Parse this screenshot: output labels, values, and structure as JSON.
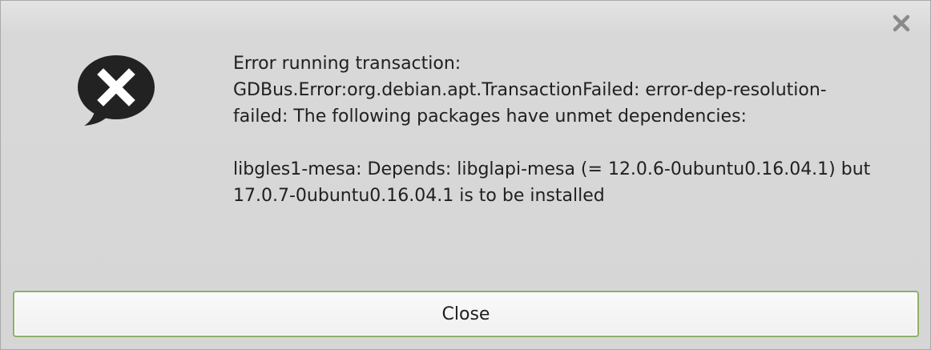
{
  "dialog": {
    "close_icon": "close-icon",
    "error_icon": "error-speech-bubble-icon",
    "message": {
      "heading": "Error running transaction:",
      "error_line": "GDBus.Error:org.debian.apt.TransactionFailed: error-dep-resolution-\nfailed: The following packages have unmet dependencies:",
      "detail": "libgles1-mesa: Depends: libglapi-mesa (= 12.0.6-0ubuntu0.16.04.1) but\n17.0.7-0ubuntu0.16.04.1 is to be installed"
    },
    "close_button_label": "Close"
  },
  "colors": {
    "background": "#d6d6d6",
    "icon": "#222222",
    "button_border": "#8eb06a",
    "text": "#202020"
  }
}
